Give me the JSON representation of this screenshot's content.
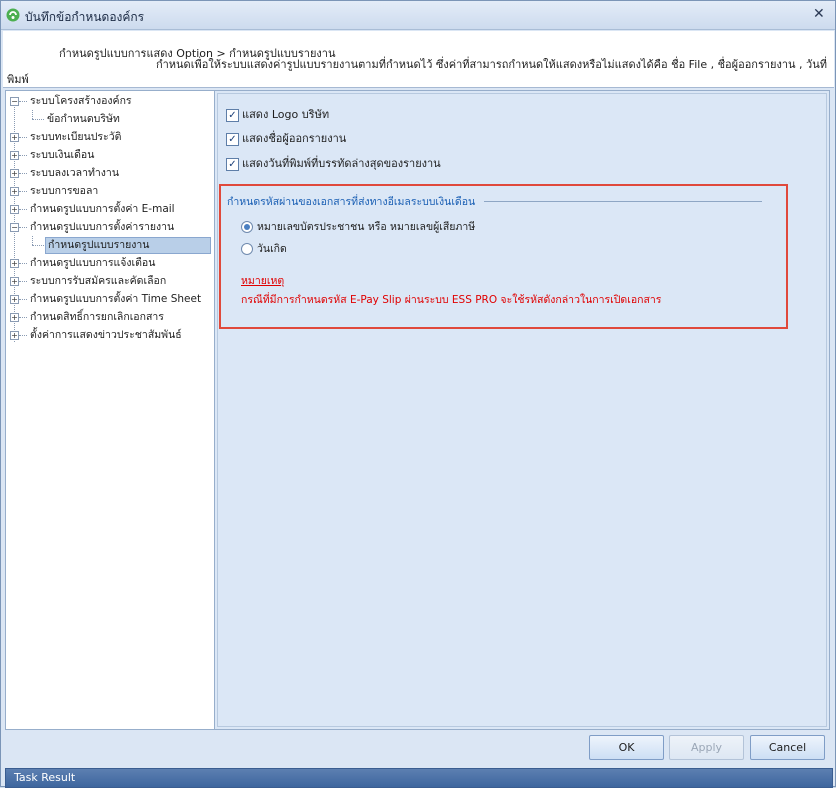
{
  "window": {
    "title": "บันทึกข้อกำหนดองค์กร"
  },
  "header": {
    "breadcrumb": "กำหนดรูปแบบการแสดง Option > กำหนดรูปแบบรายงาน",
    "description": "กำหนดเพื่อให้ระบบแสดงค่ารูปแบบรายงานตามที่กำหนดไว้ ซึ่งค่าที่สามารถกำหนดให้แสดงหรือไม่แสดงได้คือ ชื่อ File , ชื่อผู้ออกรายงาน , วันที่",
    "description_cont": "พิมพ์"
  },
  "tree": [
    {
      "label": "ระบบโครงสร้างองค์กร",
      "toggle": "−",
      "level": 0
    },
    {
      "label": "ข้อกำหนดบริษัท",
      "toggle": "",
      "level": 1
    },
    {
      "label": "ระบบทะเบียนประวัติ",
      "toggle": "+",
      "level": 0
    },
    {
      "label": "ระบบเงินเดือน",
      "toggle": "+",
      "level": 0
    },
    {
      "label": "ระบบลงเวลาทำงาน",
      "toggle": "+",
      "level": 0
    },
    {
      "label": "ระบบการขอลา",
      "toggle": "+",
      "level": 0
    },
    {
      "label": "กำหนดรูปแบบการตั้งค่า E-mail",
      "toggle": "+",
      "level": 0
    },
    {
      "label": "กำหนดรูปแบบการตั้งค่ารายงาน",
      "toggle": "−",
      "level": 0
    },
    {
      "label": "กำหนดรูปแบบรายงาน",
      "toggle": "",
      "level": 1,
      "selected": true
    },
    {
      "label": "กำหนดรูปแบบการแจ้งเตือน",
      "toggle": "+",
      "level": 0
    },
    {
      "label": "ระบบการรับสมัครและคัดเลือก",
      "toggle": "+",
      "level": 0
    },
    {
      "label": "กำหนดรูปแบบการตั้งค่า Time Sheet",
      "toggle": "+",
      "level": 0
    },
    {
      "label": "กำหนดสิทธิ์การยกเลิกเอกสาร",
      "toggle": "+",
      "level": 0
    },
    {
      "label": "ตั้งค่าการแสดงข่าวประชาสัมพันธ์",
      "toggle": "+",
      "level": 0
    }
  ],
  "options": {
    "show_logo": {
      "label": "แสดง Logo บริษัท",
      "checked": true
    },
    "show_reporter": {
      "label": "แสดงชื่อผู้ออกรายงาน",
      "checked": true
    },
    "show_print_date": {
      "label": "แสดงวันที่พิมพ์ที่บรรทัดล่างสุดของรายงาน",
      "checked": true
    }
  },
  "password_group": {
    "title": "กำหนดรหัสผ่านของเอกสารที่ส่งทางอีเมลระบบเงินเดือน",
    "radio_id_card": {
      "label": "หมายเลขบัตรประชาชน หรือ หมายเลขผู้เสียภาษี",
      "selected": true
    },
    "radio_birthdate": {
      "label": "วันเกิด",
      "selected": false
    },
    "note_title": "หมายเหตุ",
    "note_text": "กรณีที่มีการกำหนดรหัส E-Pay Slip ผ่านระบบ ESS PRO จะใช้รหัสดังกล่าวในการเปิดเอกสาร"
  },
  "buttons": {
    "ok": "OK",
    "apply": "Apply",
    "cancel": "Cancel"
  },
  "taskbar": {
    "label": "Task Result"
  },
  "colors": {
    "accent_red": "#e0493b",
    "note_red": "#e00000",
    "group_title_blue": "#1a5fb4"
  },
  "icons": {
    "app": "app-logo-icon",
    "close": "close-icon",
    "check": "checkmark-icon"
  }
}
